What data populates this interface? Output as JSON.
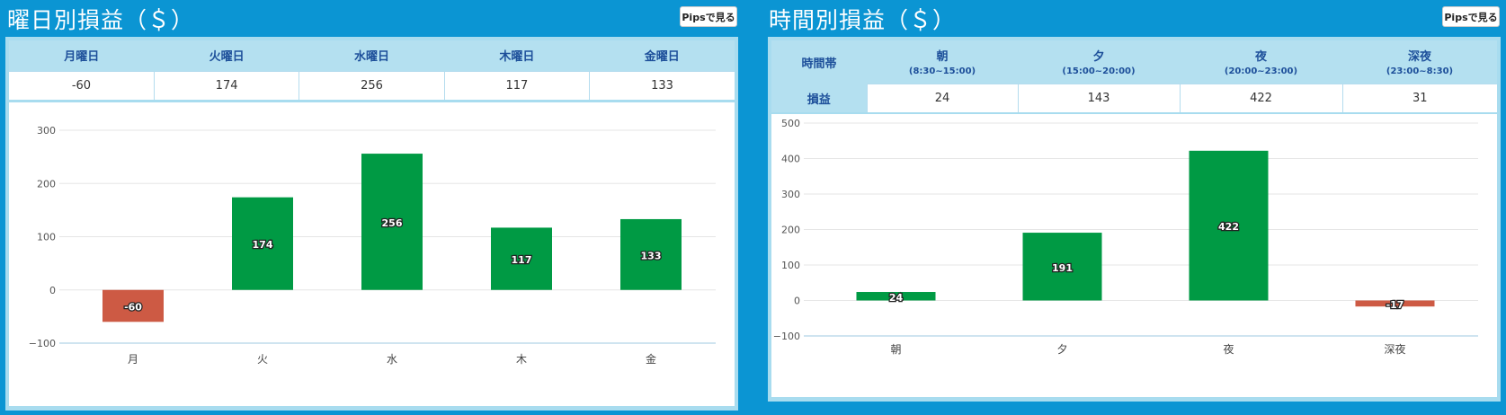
{
  "left": {
    "title": "曜日別損益（＄）",
    "pips_button": "Pipsで見る",
    "headers": [
      "月曜日",
      "火曜日",
      "水曜日",
      "木曜日",
      "金曜日"
    ],
    "values": [
      "-60",
      "174",
      "256",
      "117",
      "133"
    ]
  },
  "right": {
    "title": "時間別損益（＄）",
    "pips_button": "Pipsで見る",
    "row_header_top": "時間帯",
    "row_header_bottom": "損益",
    "headers": [
      {
        "label": "朝",
        "range": "(8:30~15:00)"
      },
      {
        "label": "夕",
        "range": "(15:00~20:00)"
      },
      {
        "label": "夜",
        "range": "(20:00~23:00)"
      },
      {
        "label": "深夜",
        "range": "(23:00~8:30)"
      }
    ],
    "values": [
      "24",
      "143",
      "422",
      "31"
    ]
  },
  "colors": {
    "positive": "#009a44",
    "negative": "#cd5a44",
    "background": "#0b95d3",
    "header": "#b4e0f0"
  },
  "chart_data": [
    {
      "type": "bar",
      "categories": [
        "月",
        "火",
        "水",
        "木",
        "金"
      ],
      "values": [
        -60,
        174,
        256,
        117,
        133
      ],
      "labels": [
        "-60",
        "174",
        "256",
        "117",
        "133"
      ],
      "yticks": [
        300,
        200,
        100,
        0,
        -100
      ],
      "ytick_labels": [
        "300",
        "200",
        "100",
        "0",
        "−100"
      ],
      "ylim": [
        -100,
        300
      ],
      "grid": true
    },
    {
      "type": "bar",
      "categories": [
        "朝",
        "夕",
        "夜",
        "深夜"
      ],
      "values": [
        24,
        191,
        422,
        -17
      ],
      "labels": [
        "24",
        "191",
        "422",
        "-17"
      ],
      "yticks": [
        500,
        400,
        300,
        200,
        100,
        0,
        -100
      ],
      "ytick_labels": [
        "500",
        "400",
        "300",
        "200",
        "100",
        "0",
        "−100"
      ],
      "ylim": [
        -100,
        500
      ],
      "grid": true
    }
  ]
}
